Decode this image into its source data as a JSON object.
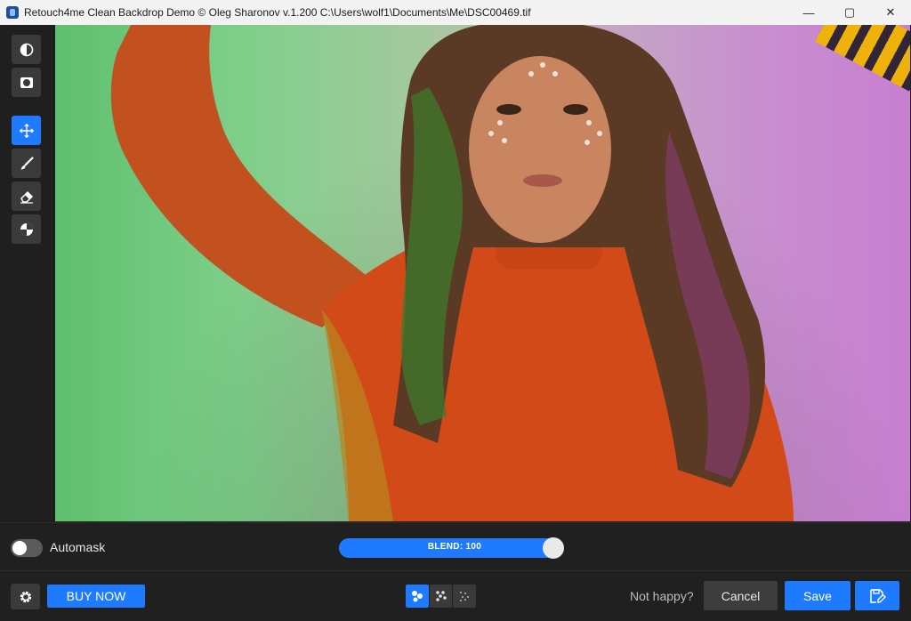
{
  "window": {
    "title": "Retouch4me Clean Backdrop Demo © Oleg Sharonov v.1.200 C:\\Users\\wolf1\\Documents\\Me\\DSC00469.tif",
    "minimize_glyph": "—",
    "maximize_glyph": "▢",
    "close_glyph": "✕"
  },
  "toolbar": {
    "tools": [
      {
        "icon": "half-circle-icon",
        "active": false
      },
      {
        "icon": "mask-icon",
        "active": false
      },
      {
        "icon": "move-icon",
        "active": true
      },
      {
        "icon": "brush-icon",
        "active": false
      },
      {
        "icon": "eraser-icon",
        "active": false
      },
      {
        "icon": "contrast-icon",
        "active": false
      }
    ]
  },
  "controls": {
    "automask_label": "Automask",
    "automask_on": false,
    "blend_label": "BLEND: 100",
    "blend_value": 100
  },
  "footer": {
    "buy_label": "BUY NOW",
    "not_happy_label": "Not happy?",
    "cancel_label": "Cancel",
    "save_label": "Save",
    "view_modes": [
      "view-mode-large-dots-icon",
      "view-mode-medium-dots-icon",
      "view-mode-small-dots-icon"
    ],
    "active_view_mode": 0
  },
  "colors": {
    "accent": "#1e7bff",
    "panel": "#202020",
    "button": "#3a3a3a"
  }
}
